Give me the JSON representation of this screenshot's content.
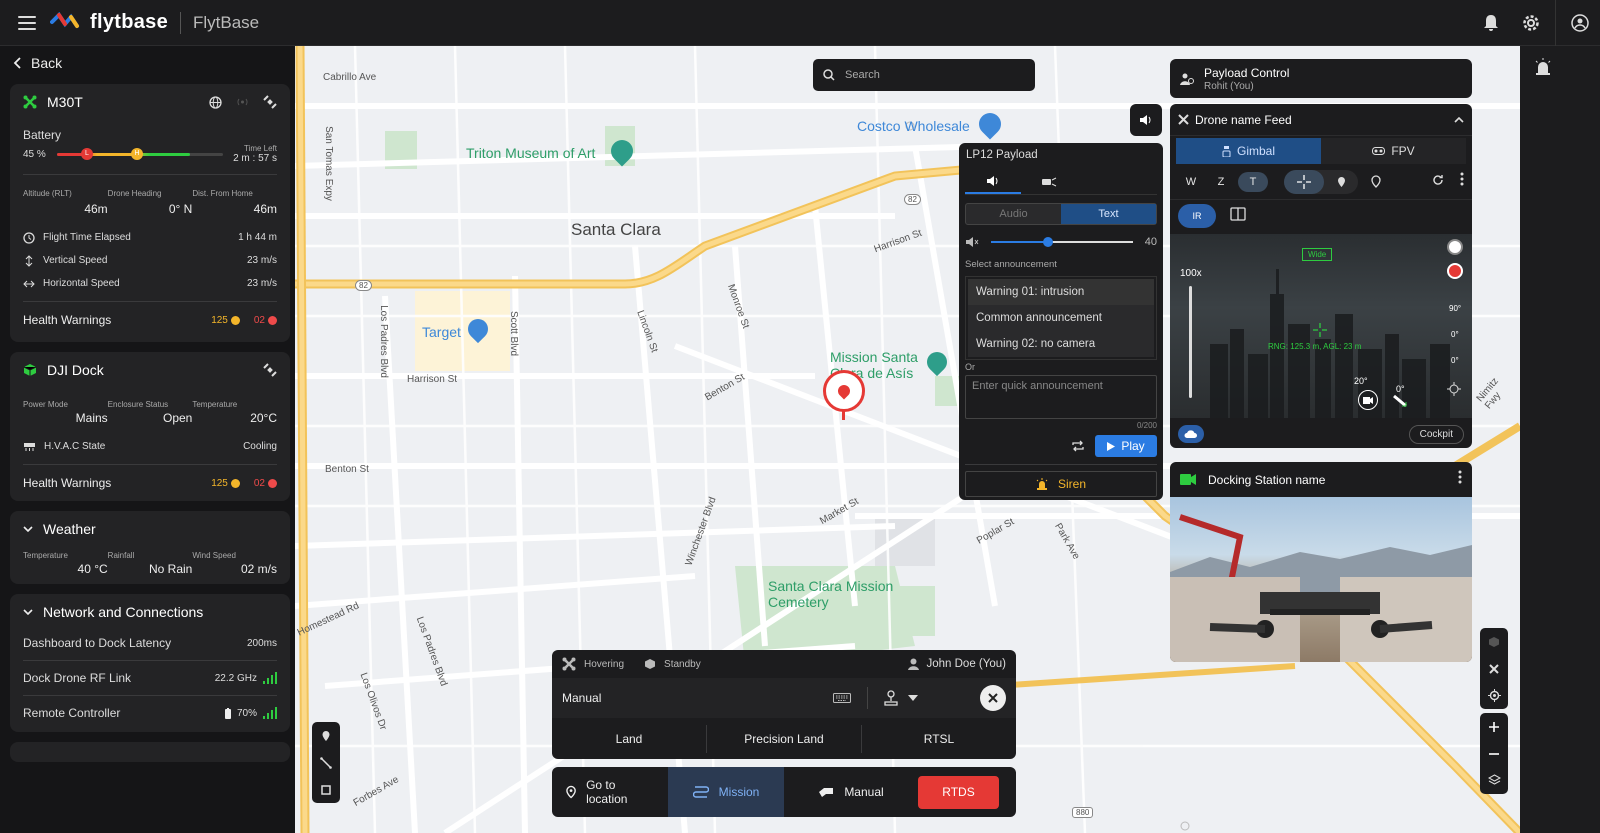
{
  "app": {
    "logo_text": "flytbase",
    "org": "FlytBase"
  },
  "nav": {
    "back": "Back"
  },
  "drone": {
    "name": "M30T",
    "battery_label": "Battery",
    "battery_pct": "45 %",
    "battery_level": 45,
    "time_left_label": "Time Left",
    "time_left": "2 m : 57 s",
    "altitude_label": "Altitude (RLT)",
    "altitude": "46m",
    "heading_label": "Drone Heading",
    "heading": "0° N",
    "dist_label": "Dist. From Home",
    "dist": "46m",
    "flight_time_label": "Flight Time Elapsed",
    "flight_time": "1 h 44 m",
    "vspeed_label": "Vertical Speed",
    "vspeed": "23 m/s",
    "hspeed_label": "Horizontal Speed",
    "hspeed": "23 m/s",
    "health_label": "Health Warnings",
    "health_warn": "125",
    "health_err": "02"
  },
  "dock": {
    "name": "DJI Dock",
    "power_label": "Power Mode",
    "power": "Mains",
    "enclosure_label": "Enclosure Status",
    "enclosure": "Open",
    "temp_label": "Temperature",
    "temp": "20°C",
    "hvac_label": "H.V.A.C State",
    "hvac": "Cooling",
    "health_label": "Health Warnings",
    "health_warn": "125",
    "health_err": "02"
  },
  "weather": {
    "title": "Weather",
    "temp_label": "Temperature",
    "temp": "40 °C",
    "rain_label": "Rainfall",
    "rain": "No Rain",
    "wind_label": "Wind Speed",
    "wind": "02 m/s"
  },
  "network": {
    "title": "Network and Connections",
    "latency_label": "Dashboard to Dock Latency",
    "latency": "200ms",
    "rf_label": "Dock Drone RF Link",
    "rf": "22.2 GHz",
    "rc_label": "Remote Controller",
    "rc": "70%"
  },
  "search": {
    "placeholder": "Search"
  },
  "map": {
    "labels": [
      "Cabrillo Ave",
      "San Tomas Expy",
      "Triton Museum of Art",
      "Costco Wholesale",
      "Santa Clara",
      "Harrison St",
      "Target",
      "Los Padres Blvd",
      "Scott Blvd",
      "Lincoln St",
      "Monroe St",
      "Benton St",
      "Mission Santa Clara de Asís",
      "Winchester Blvd",
      "Market St",
      "Santa Clara Mission Cemetery",
      "Homestead Rd",
      "Los Olivos Dr",
      "Forbes Ave",
      "Poplar St",
      "Park Ave",
      "Nimitz Fwy"
    ],
    "road_numbers": [
      "82",
      "82",
      "82",
      "880"
    ]
  },
  "payload": {
    "title": "LP12 Payload",
    "tab_audio": "Audio",
    "tab_text": "Text",
    "volume": "40",
    "volume_level": 40,
    "select_label": "Select announcement",
    "announcements": [
      "Warning 01: intrusion",
      "Common announcement",
      "Warning 02: no camera"
    ],
    "or": "Or",
    "quick_placeholder": "Enter quick announcement",
    "char_count": "0/200",
    "play": "Play",
    "siren": "Siren"
  },
  "payload_control": {
    "title": "Payload Control",
    "user": "Rohit (You)"
  },
  "feed": {
    "title": "Drone name Feed",
    "tab_gimbal": "Gimbal",
    "tab_fpv": "FPV",
    "w": "W",
    "z": "Z",
    "t": "T",
    "ir": "IR",
    "zoom": "100x",
    "wide": "Wide",
    "rng": "RNG: 125.3 m, AGL: 23 m",
    "pitch": "20°",
    "yaw": "0°",
    "side1": "90°",
    "side2": "0°",
    "side3": "0°",
    "cockpit": "Cockpit"
  },
  "docking": {
    "title": "Docking Station name"
  },
  "control": {
    "status": "Hovering",
    "dock_status": "Standby",
    "user": "John Doe (You)",
    "mode": "Manual",
    "land": "Land",
    "precision_land": "Precision Land",
    "rtsl": "RTSL",
    "goto": "Go to location",
    "mission": "Mission",
    "manual": "Manual",
    "rtds": "RTDS"
  },
  "colors": {
    "accent": "#2b7ce3",
    "danger": "#e53935",
    "warn": "#f3b52a",
    "ok": "#2ecc40",
    "map_bg": "#eef0f3",
    "road": "#f7c96a"
  }
}
